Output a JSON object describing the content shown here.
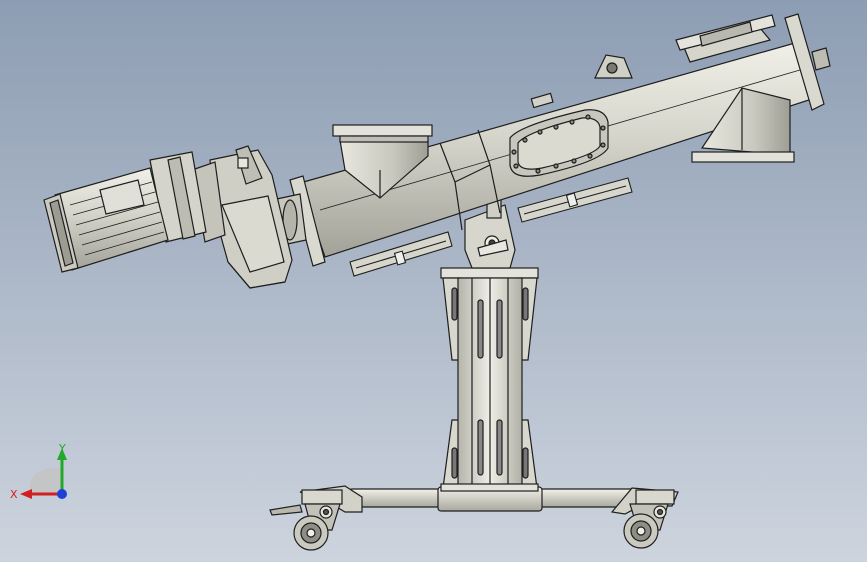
{
  "viewport": {
    "background_top": "#8d9db3",
    "background_bottom": "#cdd4de"
  },
  "model": {
    "metal_light": "#e8e8df",
    "metal_mid": "#c9c9bf",
    "metal_dark": "#8f8f86",
    "edge": "#1e1e1e"
  },
  "triad": {
    "x_label": "X",
    "y_label": "Y",
    "x_color": "#d21f1f",
    "y_color": "#22a82a",
    "z_color": "#1f3fd8"
  }
}
